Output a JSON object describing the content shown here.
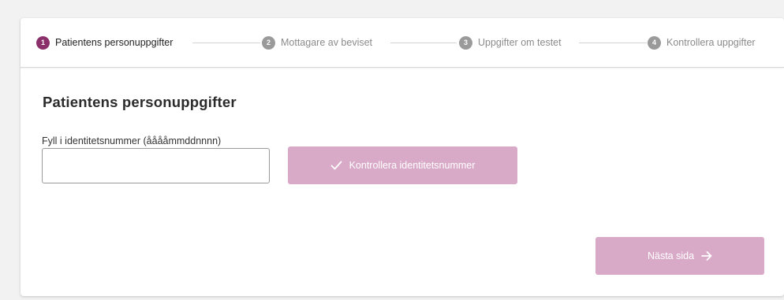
{
  "stepper": {
    "steps": [
      {
        "number": "1",
        "label": "Patientens personuppgifter",
        "state": "active"
      },
      {
        "number": "2",
        "label": "Mottagare av beviset",
        "state": "inactive"
      },
      {
        "number": "3",
        "label": "Uppgifter om testet",
        "state": "inactive"
      },
      {
        "number": "4",
        "label": "Kontrollera uppgifter",
        "state": "inactive"
      }
    ]
  },
  "form": {
    "title": "Patientens personuppgifter",
    "id_label": "Fyll i identitetsnummer (ååååmmddnnnn)",
    "id_value": "",
    "check_button_label": "Kontrollera identitetsnummer",
    "check_button_icon": "checkmark-icon"
  },
  "footer": {
    "next_button_label": "Nästa sida",
    "next_button_icon": "arrow-right-icon"
  },
  "colors": {
    "accent": "#8b2f6a",
    "button_disabled": "#d9aac8",
    "inactive_step": "#9a9a9a"
  }
}
